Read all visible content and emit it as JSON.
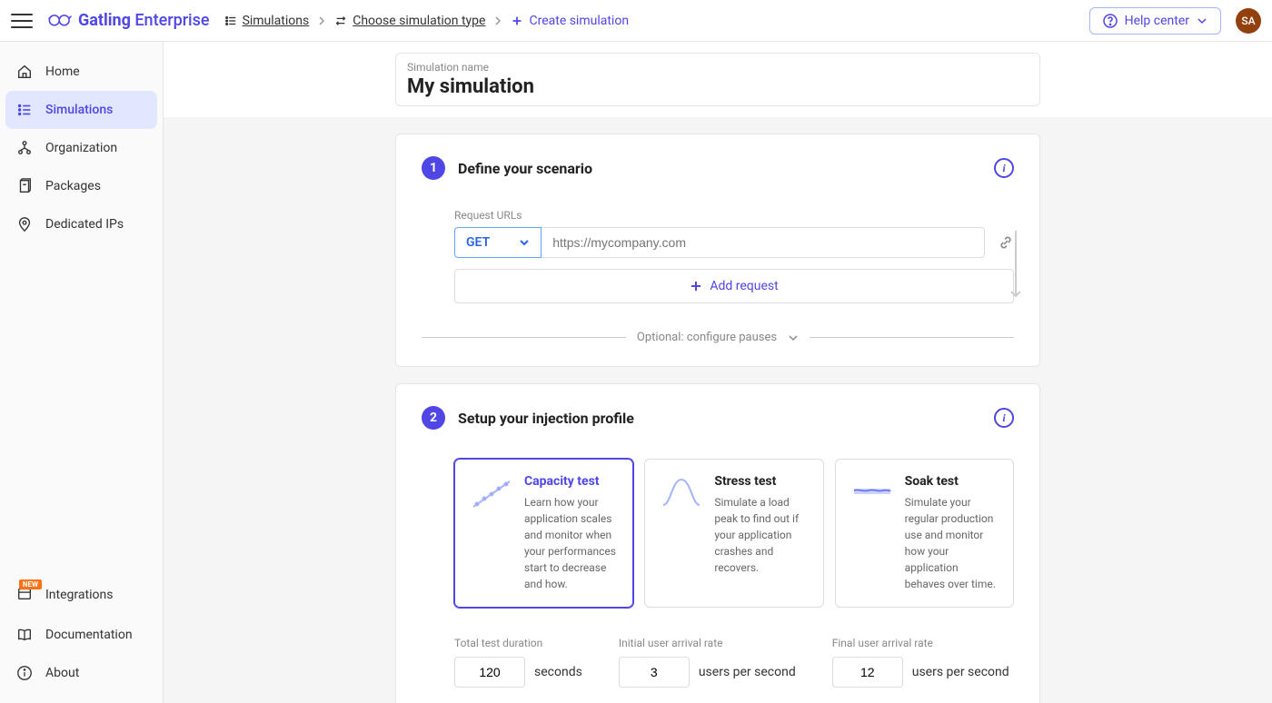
{
  "header": {
    "logo_text": "Gatling Enterprise",
    "breadcrumb": [
      {
        "label": "Simulations"
      },
      {
        "label": "Choose simulation type"
      },
      {
        "label": "Create simulation"
      }
    ],
    "help_center": "Help center",
    "avatar": "SA"
  },
  "sidebar": {
    "top": [
      {
        "label": "Home",
        "icon": "home"
      },
      {
        "label": "Simulations",
        "icon": "list",
        "active": true
      },
      {
        "label": "Organization",
        "icon": "org"
      },
      {
        "label": "Packages",
        "icon": "package"
      },
      {
        "label": "Dedicated IPs",
        "icon": "location"
      }
    ],
    "bottom": [
      {
        "label": "Integrations",
        "icon": "integrations",
        "badge": "NEW"
      },
      {
        "label": "Documentation",
        "icon": "book"
      },
      {
        "label": "About",
        "icon": "info"
      }
    ]
  },
  "simulation": {
    "name_label": "Simulation name",
    "name_value": "My simulation"
  },
  "section1": {
    "number": "1",
    "title": "Define your scenario",
    "request_urls_label": "Request URLs",
    "method": "GET",
    "url_placeholder": "https://mycompany.com",
    "add_request": "Add request",
    "optional_text": "Optional: configure pauses"
  },
  "section2": {
    "number": "2",
    "title": "Setup your injection profile",
    "profiles": [
      {
        "title": "Capacity test",
        "desc": "Learn how your application scales and monitor when your performances start to decrease and how.",
        "selected": true,
        "type": "capacity"
      },
      {
        "title": "Stress test",
        "desc": "Simulate a load peak to find out if your application crashes and recovers.",
        "selected": false,
        "type": "stress"
      },
      {
        "title": "Soak test",
        "desc": "Simulate your regular production use and monitor how your application behaves over time.",
        "selected": false,
        "type": "soak"
      }
    ],
    "params": [
      {
        "label": "Total test duration",
        "value": "120",
        "unit": "seconds"
      },
      {
        "label": "Initial user arrival rate",
        "value": "3",
        "unit": "users per second"
      },
      {
        "label": "Final user arrival rate",
        "value": "12",
        "unit": "users per second"
      }
    ]
  }
}
